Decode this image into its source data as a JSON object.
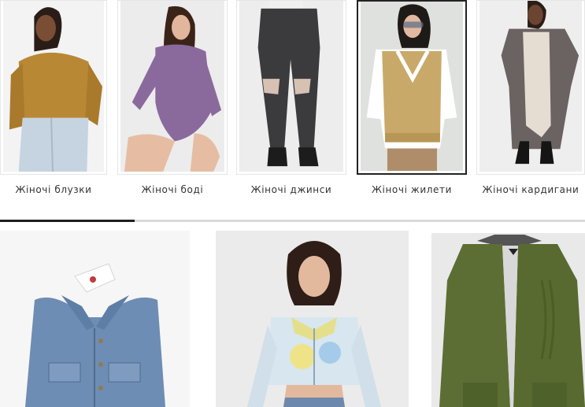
{
  "categories": [
    {
      "label": "Жіночі блузки",
      "icon": "women-blouse-photo"
    },
    {
      "label": "Жіночі боді",
      "icon": "women-bodysuit-photo"
    },
    {
      "label": "Жіночі джинси",
      "icon": "women-jeans-photo"
    },
    {
      "label": "Жіночі жилети",
      "icon": "women-vest-photo",
      "active": true
    },
    {
      "label": "Жіночі кардигани",
      "icon": "women-cardigan-photo"
    }
  ],
  "carousel": {
    "scroll_progress": 0.23
  },
  "products": [
    {
      "icon": "denim-vest-photo"
    },
    {
      "icon": "cropped-zip-cardigan-photo"
    },
    {
      "icon": "green-knit-cardigan-photo"
    }
  ],
  "colors": {
    "active_border": "#222222",
    "scroll_thumb": "#1e1e1e",
    "scroll_track": "#d9d9d9"
  }
}
